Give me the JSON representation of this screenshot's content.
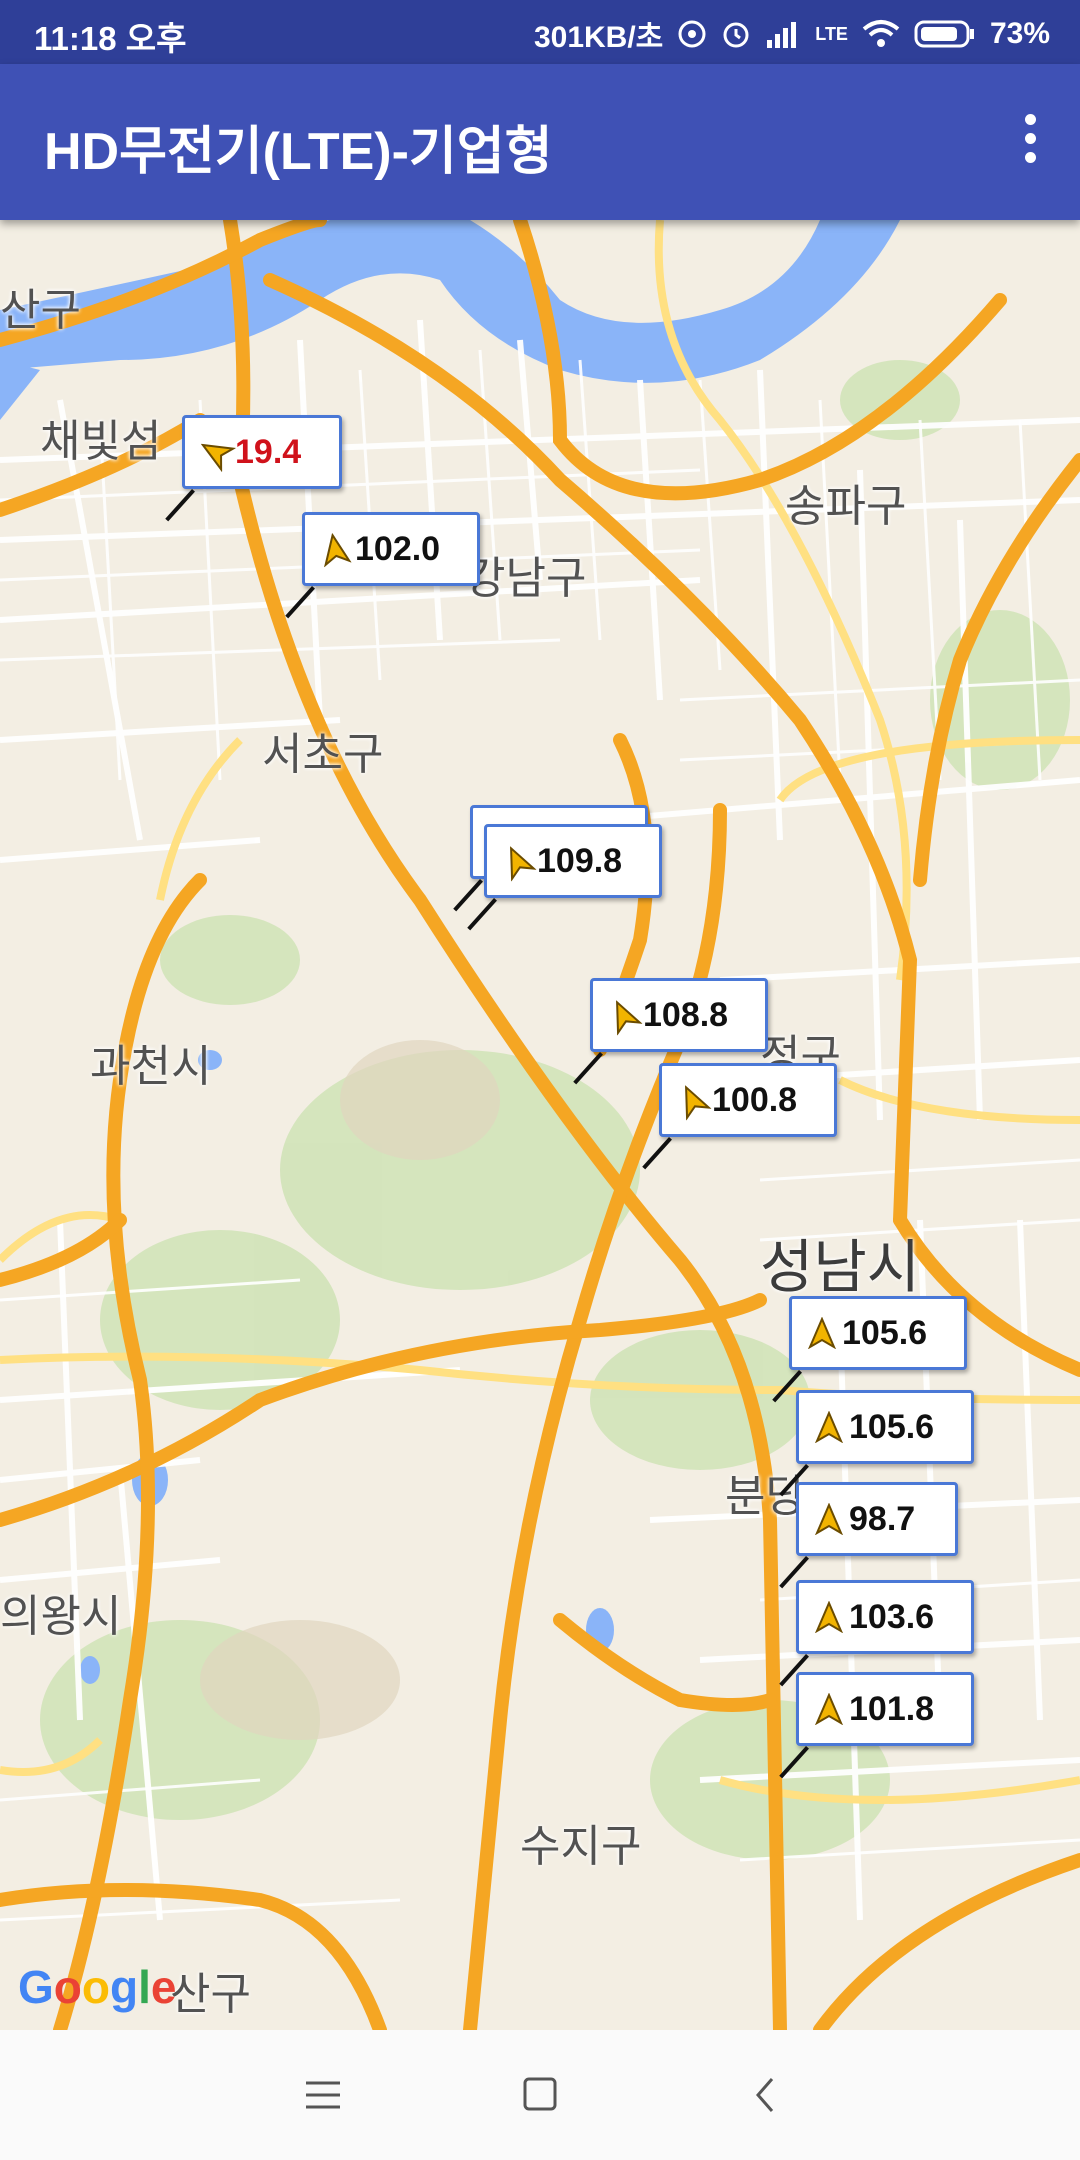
{
  "status": {
    "time": "11:18 오후",
    "speed": "301KB/초",
    "battery": "73%",
    "network": "LTE"
  },
  "appbar": {
    "title": "HD무전기(LTE)-기업형",
    "menu_icon": "more-vert-icon"
  },
  "map": {
    "places": [
      {
        "name": "채빛섬",
        "size": "normal"
      },
      {
        "name": "강남구",
        "size": "normal"
      },
      {
        "name": "송파구",
        "size": "normal"
      },
      {
        "name": "서초구",
        "size": "normal"
      },
      {
        "name": "과천시",
        "size": "normal"
      },
      {
        "name": "정구",
        "size": "normal"
      },
      {
        "name": "성남시",
        "size": "big"
      },
      {
        "name": "분당",
        "size": "normal"
      },
      {
        "name": "의왕시",
        "size": "normal"
      },
      {
        "name": "수지구",
        "size": "normal"
      },
      {
        "name": "산구",
        "size": "normal"
      },
      {
        "name": "산구",
        "size": "normal"
      }
    ],
    "markers": [
      {
        "value": "19.4",
        "color": "#d0121b",
        "alert": true
      },
      {
        "value": "102.0",
        "color": "#111111",
        "alert": false
      },
      {
        "value": "",
        "color": "#111111",
        "alert": false
      },
      {
        "value": "109.8",
        "color": "#111111",
        "alert": false
      },
      {
        "value": "108.8",
        "color": "#111111",
        "alert": false
      },
      {
        "value": "100.8",
        "color": "#111111",
        "alert": false
      },
      {
        "value": "105.6",
        "color": "#111111",
        "alert": false
      },
      {
        "value": "105.6",
        "color": "#111111",
        "alert": false
      },
      {
        "value": "98.7",
        "color": "#111111",
        "alert": false
      },
      {
        "value": "103.6",
        "color": "#111111",
        "alert": false
      },
      {
        "value": "101.8",
        "color": "#111111",
        "alert": false
      }
    ],
    "attribution": "Google"
  },
  "navbar": {
    "menu_icon": "menu-icon",
    "home_icon": "home-square-icon",
    "back_icon": "back-chevron-icon"
  }
}
